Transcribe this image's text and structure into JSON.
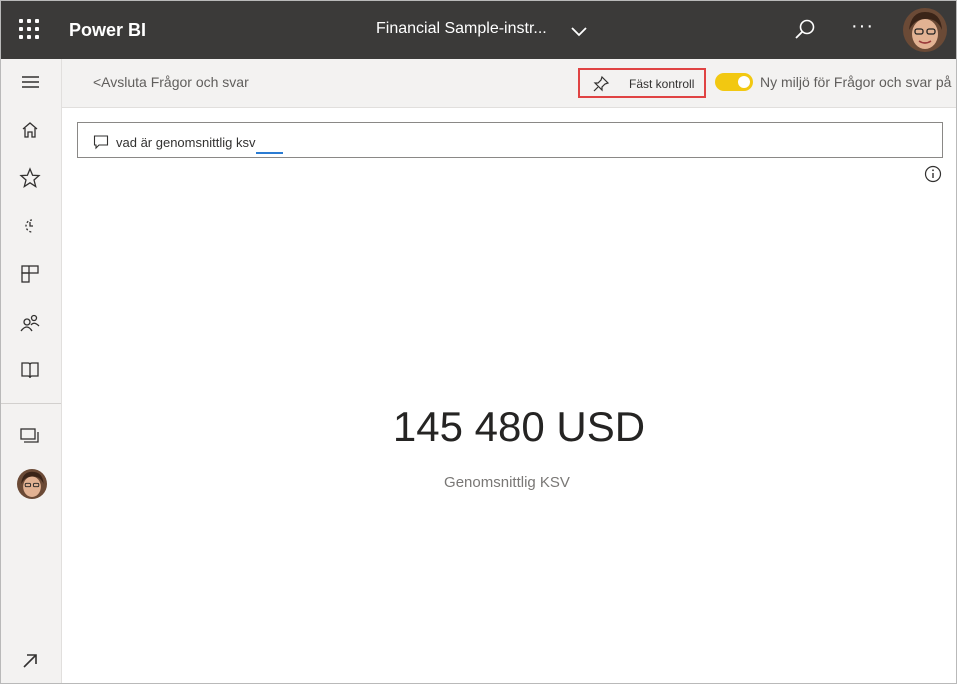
{
  "header": {
    "brand": "Power BI",
    "report_title": "Financial Sample-instr..."
  },
  "subbar": {
    "exit_label": "<Avsluta Frågor och svar",
    "pin_label": "Fäst kontroll",
    "new_experience_label": "Ny miljö för Frågor och svar på",
    "toggle_on": true
  },
  "qna": {
    "query": "vad är genomsnittlig ksv"
  },
  "result": {
    "value": "145 480 USD",
    "label": "Genomsnittlig KSV"
  },
  "nav_icons": [
    "menu-icon",
    "home-icon",
    "star-icon",
    "recent-icon",
    "apps-icon",
    "shared-icon",
    "learn-icon",
    "workspaces-icon",
    "profile-avatar",
    "expand-icon"
  ],
  "colors": {
    "header_bg": "#3b3a39",
    "toggle_accent": "#f2c811",
    "highlight_border": "#e04343",
    "underline_accent": "#2b7cd3"
  }
}
